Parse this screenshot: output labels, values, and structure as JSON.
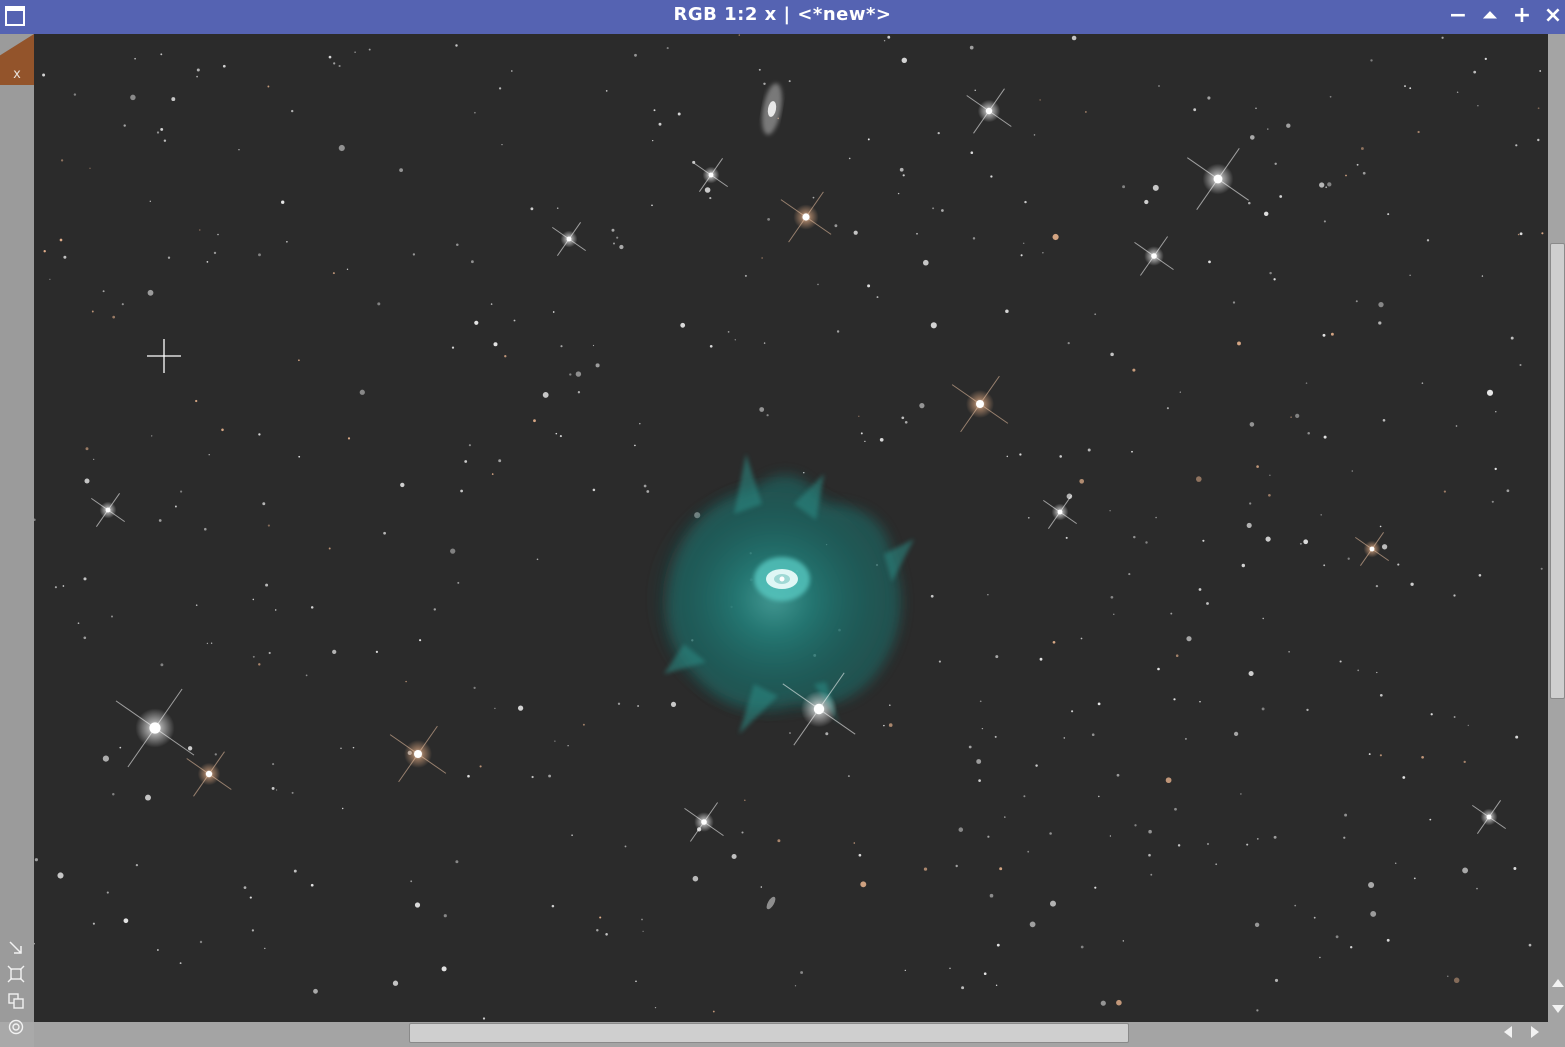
{
  "window": {
    "title": "RGB 1:2 x | <*new*>",
    "controls": {
      "minimize": "−",
      "shade": "⏶",
      "maximize": "+",
      "close": "×"
    }
  },
  "sidebar": {
    "close_tab_label": "x",
    "tools": [
      "resize-icon",
      "fit-view-icon",
      "clone-view-icon",
      "target-icon"
    ]
  },
  "colors": {
    "titlebar": "#5563b2",
    "sky_background": "#2b2b2b",
    "close_tab": "#93542b",
    "nebula_outer": "#1f6e6a",
    "nebula_inner": "#56c7c0"
  }
}
